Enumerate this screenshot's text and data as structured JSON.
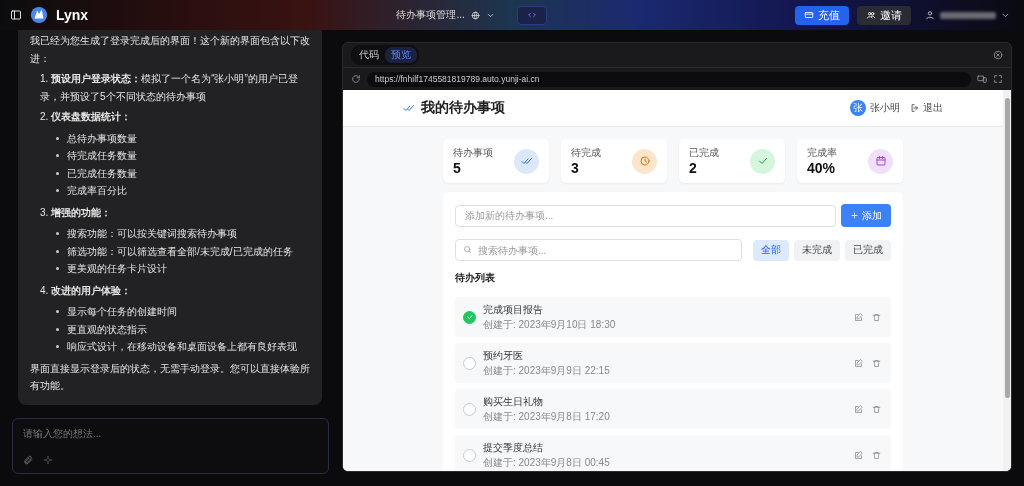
{
  "topbar": {
    "brand": "Lynx",
    "project_title": "待办事项管理...",
    "recharge_button": "充值",
    "invite_button": "邀请"
  },
  "chat": {
    "intro": "我已经为您生成了登录完成后的界面！这个新的界面包含以下改进：",
    "sections": [
      {
        "heading": "1. **预设用户登录状态：**模拟了一个名为“张小明”的用户已登录，并预设了5个不同状态的待办事项"
      },
      {
        "heading": "2. **仪表盘数据统计：**",
        "items": [
          "总待办事项数量",
          "待完成任务数量",
          "已完成任务数量",
          "完成率百分比"
        ]
      },
      {
        "heading": "3. **增强的功能：**",
        "items": [
          "搜索功能：可以按关键词搜索待办事项",
          "筛选功能：可以筛选查看全部/未完成/已完成的任务",
          "更美观的任务卡片设计"
        ]
      },
      {
        "heading": "4. **改进的用户体验：**",
        "items": [
          "显示每个任务的创建时间",
          "更直观的状态指示",
          "响应式设计，在移动设备和桌面设备上都有良好表现"
        ]
      }
    ],
    "closing": "界面直接显示登录后的状态，无需手动登录。您可以直接体验所有功能。"
  },
  "composer": {
    "placeholder": "请输入您的想法..."
  },
  "preview": {
    "tabs": [
      {
        "label": "代码",
        "selected": false
      },
      {
        "label": "预览",
        "selected": true
      }
    ],
    "url": "https://fnhilf1745581819789.auto.yunji-ai.cn",
    "app": {
      "title": "我的待办事项",
      "user_initial": "张",
      "user_name": "张小明",
      "logout": "退出",
      "stats": [
        {
          "label": "待办事项",
          "value": "5",
          "kind": "total"
        },
        {
          "label": "待完成",
          "value": "3",
          "kind": "pending"
        },
        {
          "label": "已完成",
          "value": "2",
          "kind": "done"
        },
        {
          "label": "完成率",
          "value": "40%",
          "kind": "rate"
        }
      ],
      "new_todo_placeholder": "添加新的待办事项...",
      "add_button": "添加",
      "search_placeholder": "搜索待办事项...",
      "filters": [
        {
          "label": "全部",
          "selected": true
        },
        {
          "label": "未完成",
          "selected": false
        },
        {
          "label": "已完成",
          "selected": false
        }
      ],
      "list_title": "待办列表",
      "todos": [
        {
          "title": "完成项目报告",
          "created": "创建于: 2023年9月10日 18:30",
          "completed": true
        },
        {
          "title": "预约牙医",
          "created": "创建于: 2023年9月9日 22:15",
          "completed": false
        },
        {
          "title": "购买生日礼物",
          "created": "创建于: 2023年9月8日 17:20",
          "completed": false
        },
        {
          "title": "提交季度总结",
          "created": "创建于: 2023年9月8日 00:45",
          "completed": false
        }
      ]
    }
  }
}
